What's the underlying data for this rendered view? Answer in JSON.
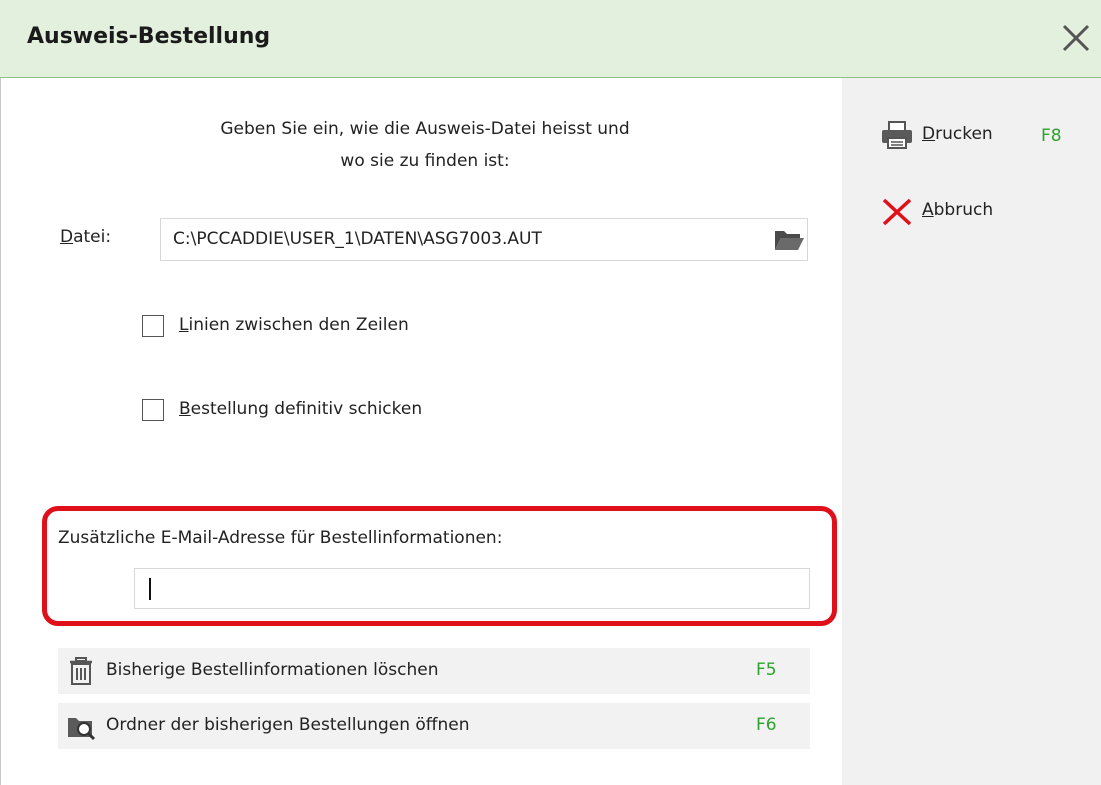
{
  "window": {
    "title": "Ausweis-Bestellung",
    "close_icon": "close-x-icon"
  },
  "instruction": {
    "line1": "Geben Sie ein, wie die Ausweis-Datei heisst und",
    "line2": "wo sie zu finden ist:"
  },
  "file": {
    "label": "Datei:",
    "value": "C:\\PCCADDIE\\USER_1\\DATEN\\ASG7003.AUT",
    "browse_icon": "folder-open-icon"
  },
  "options": [
    {
      "label": "Linien zwischen den Zeilen",
      "checked": false
    },
    {
      "label": "Bestellung definitiv schicken",
      "checked": false
    }
  ],
  "email": {
    "label": "Zusätzliche E-Mail-Adresse für Bestellinformationen:",
    "value": "",
    "highlight_color": "#e0101a"
  },
  "actions": [
    {
      "label": "Bisherige Bestellinformationen löschen",
      "key": "F5",
      "icon": "trash-icon"
    },
    {
      "label": "Ordner der bisherigen Bestellungen öffnen",
      "key": "F6",
      "icon": "folder-search-icon"
    }
  ],
  "sidebar": {
    "print": {
      "label": "Drucken",
      "key": "F8",
      "icon": "printer-icon"
    },
    "cancel": {
      "label": "Abbruch",
      "icon": "red-x-icon"
    }
  },
  "colors": {
    "titlebar_bg": "#e3f0dd",
    "accent_green": "#2ea22e",
    "cancel_red": "#e0101a"
  }
}
